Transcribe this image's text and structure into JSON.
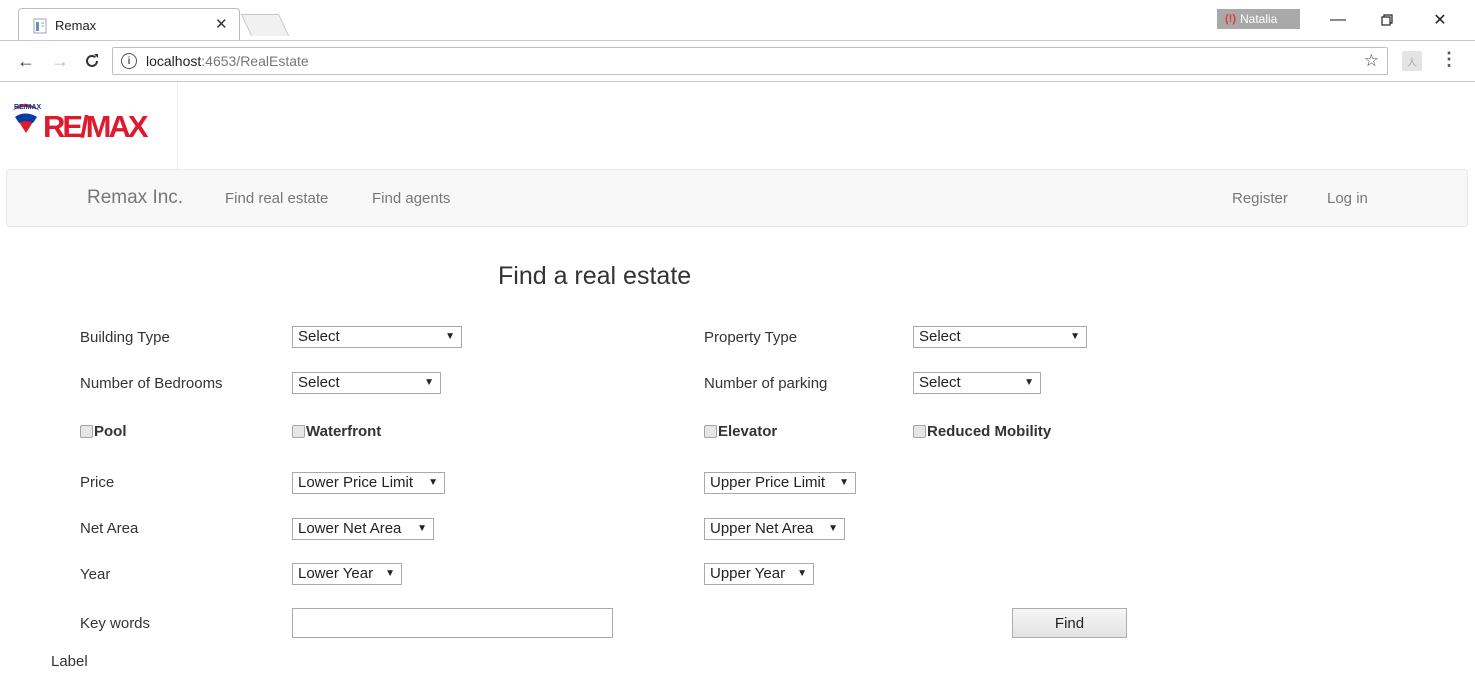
{
  "browser": {
    "tab_title": "Remax",
    "profile_name": "Natalia",
    "url_host": "localhost",
    "url_rest": ":4653/RealEstate"
  },
  "navbar": {
    "brand": "Remax Inc.",
    "links": [
      "Find real estate",
      "Find agents"
    ],
    "right_links": [
      "Register",
      "Log in"
    ]
  },
  "logo": {
    "text": "RE/MAX"
  },
  "page": {
    "title": "Find a real estate",
    "building_type_label": "Building Type",
    "building_type_value": "Select",
    "property_type_label": "Property Type",
    "property_type_value": "Select",
    "bedrooms_label": "Number of Bedrooms",
    "bedrooms_value": "Select",
    "parking_label": "Number of parking",
    "parking_value": "Select",
    "pool_label": "Pool",
    "waterfront_label": "Waterfront",
    "elevator_label": "Elevator",
    "reduced_mobility_label": "Reduced Mobility",
    "price_label": "Price",
    "price_lower": "Lower Price Limit",
    "price_upper": "Upper Price Limit",
    "net_area_label": "Net Area",
    "net_area_lower": "Lower Net Area",
    "net_area_upper": "Upper Net Area",
    "year_label": "Year",
    "year_lower": "Lower Year",
    "year_upper": "Upper Year",
    "keywords_label": "Key words",
    "keywords_value": "",
    "find_button": "Find",
    "footer_label": "Label"
  },
  "colors": {
    "remax_red": "#dc1c2e",
    "remax_blue": "#003da5",
    "navbar_bg": "#f8f8f8",
    "navbar_text": "#777777"
  }
}
